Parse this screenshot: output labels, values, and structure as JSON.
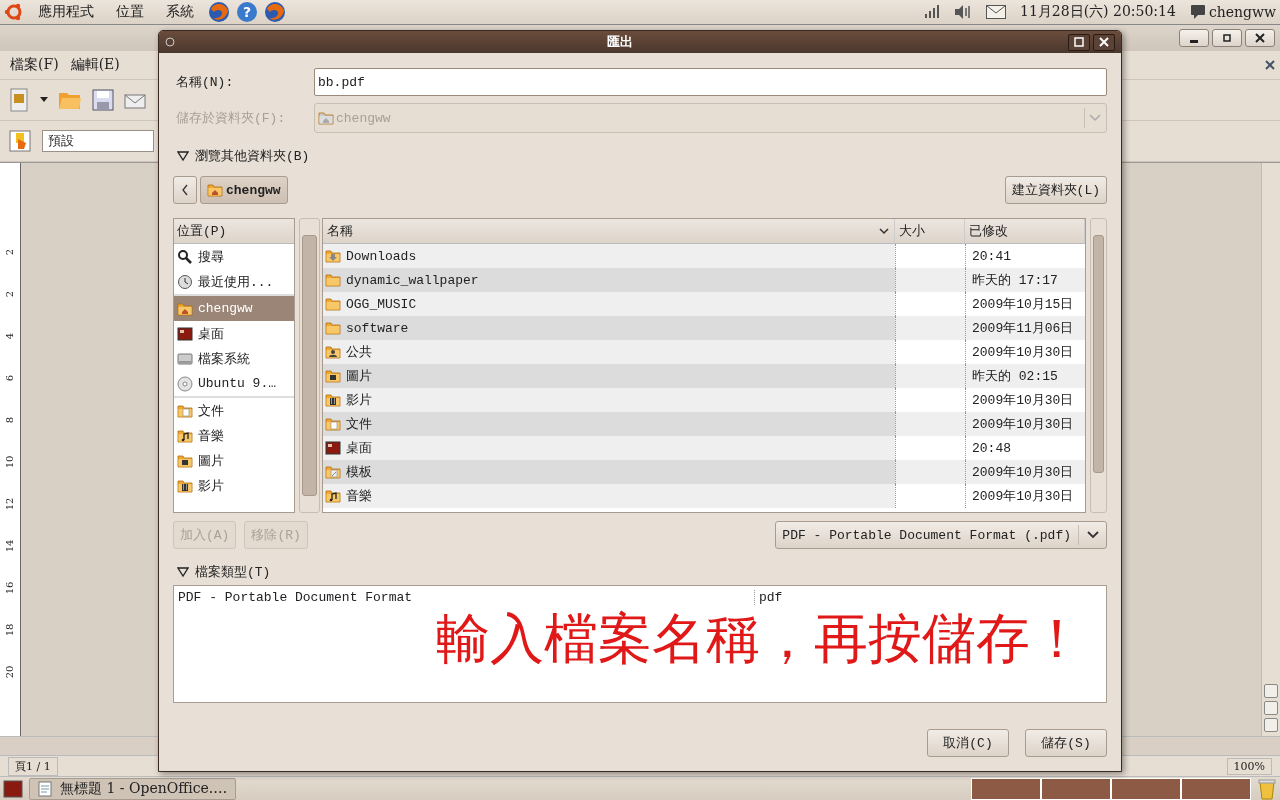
{
  "top_panel": {
    "menus": [
      "應用程式",
      "位置",
      "系統"
    ],
    "help_glyph": "?",
    "clock": "11月28日(六) 20:50:14",
    "user": "chengww"
  },
  "app_window": {
    "menus": [
      "檔案(F)",
      "編輯(E)"
    ],
    "style_field": "預設",
    "ruler_labels": [
      "2",
      "2",
      "4",
      "6",
      "8",
      "10",
      "12",
      "14",
      "16",
      "18",
      "20"
    ],
    "status_page": "頁1 / 1",
    "zoom": "100%"
  },
  "dialog": {
    "title": "匯出",
    "name_label": "名稱(N):",
    "name_value": "bb.pdf",
    "folder_label": "儲存於資料夾(F):",
    "folder_value": "chengww",
    "folder_disabled": true,
    "browse_label": "瀏覽其他資料夾(B)",
    "browse_expanded": true,
    "path": [
      {
        "label": "chengww",
        "selected": true
      }
    ],
    "create_folder": "建立資料夾(L)",
    "places": {
      "header": "位置(P)",
      "sections": [
        {
          "items": [
            {
              "label": "搜尋",
              "kind": "search",
              "selected": false
            },
            {
              "label": "最近使用...",
              "kind": "recent",
              "selected": false
            }
          ]
        },
        {
          "items": [
            {
              "label": "chengww",
              "kind": "home",
              "selected": true
            },
            {
              "label": "桌面",
              "kind": "desktop",
              "selected": false
            },
            {
              "label": "檔案系統",
              "kind": "drive",
              "selected": false
            },
            {
              "label": "Ubuntu 9.…",
              "kind": "disc",
              "selected": false
            }
          ]
        },
        {
          "items": [
            {
              "label": "文件",
              "kind": "documents",
              "selected": false
            },
            {
              "label": "音樂",
              "kind": "music",
              "selected": false
            },
            {
              "label": "圖片",
              "kind": "pictures",
              "selected": false
            },
            {
              "label": "影片",
              "kind": "videos",
              "selected": false
            }
          ]
        }
      ]
    },
    "files": {
      "columns": [
        "名稱",
        "大小",
        "已修改"
      ],
      "rows": [
        {
          "name": "Downloads",
          "kind": "downloads",
          "modified": "20:41"
        },
        {
          "name": "dynamic_wallpaper",
          "kind": "folder",
          "modified": "昨天的 17:17"
        },
        {
          "name": "OGG_MUSIC",
          "kind": "folder",
          "modified": "2009年10月15日"
        },
        {
          "name": "software",
          "kind": "folder",
          "modified": "2009年11月06日"
        },
        {
          "name": "公共",
          "kind": "public",
          "modified": "2009年10月30日"
        },
        {
          "name": "圖片",
          "kind": "pictures",
          "modified": "昨天的 02:15"
        },
        {
          "name": "影片",
          "kind": "videos",
          "modified": "2009年10月30日"
        },
        {
          "name": "文件",
          "kind": "documents",
          "modified": "2009年10月30日"
        },
        {
          "name": "桌面",
          "kind": "desktop",
          "modified": "20:48"
        },
        {
          "name": "模板",
          "kind": "templates",
          "modified": "2009年10月30日"
        },
        {
          "name": "音樂",
          "kind": "music",
          "modified": "2009年10月30日"
        }
      ]
    },
    "add_button": {
      "label": "加入(A)",
      "disabled": true
    },
    "remove_button": {
      "label": "移除(R)",
      "disabled": true
    },
    "filter": "PDF - Portable Document Format (.pdf)",
    "filetype_label": "檔案類型(T)",
    "filetype_expanded": true,
    "filetype_rows": [
      {
        "name": "PDF - Portable Document Format",
        "extension": "pdf"
      }
    ],
    "annotation": "輸入檔案名稱，再按儲存！",
    "buttons": [
      "取消(C)",
      "儲存(S)"
    ]
  },
  "taskbar": {
    "tasks": [
      "無標題 1 - OpenOffice.…"
    ]
  }
}
